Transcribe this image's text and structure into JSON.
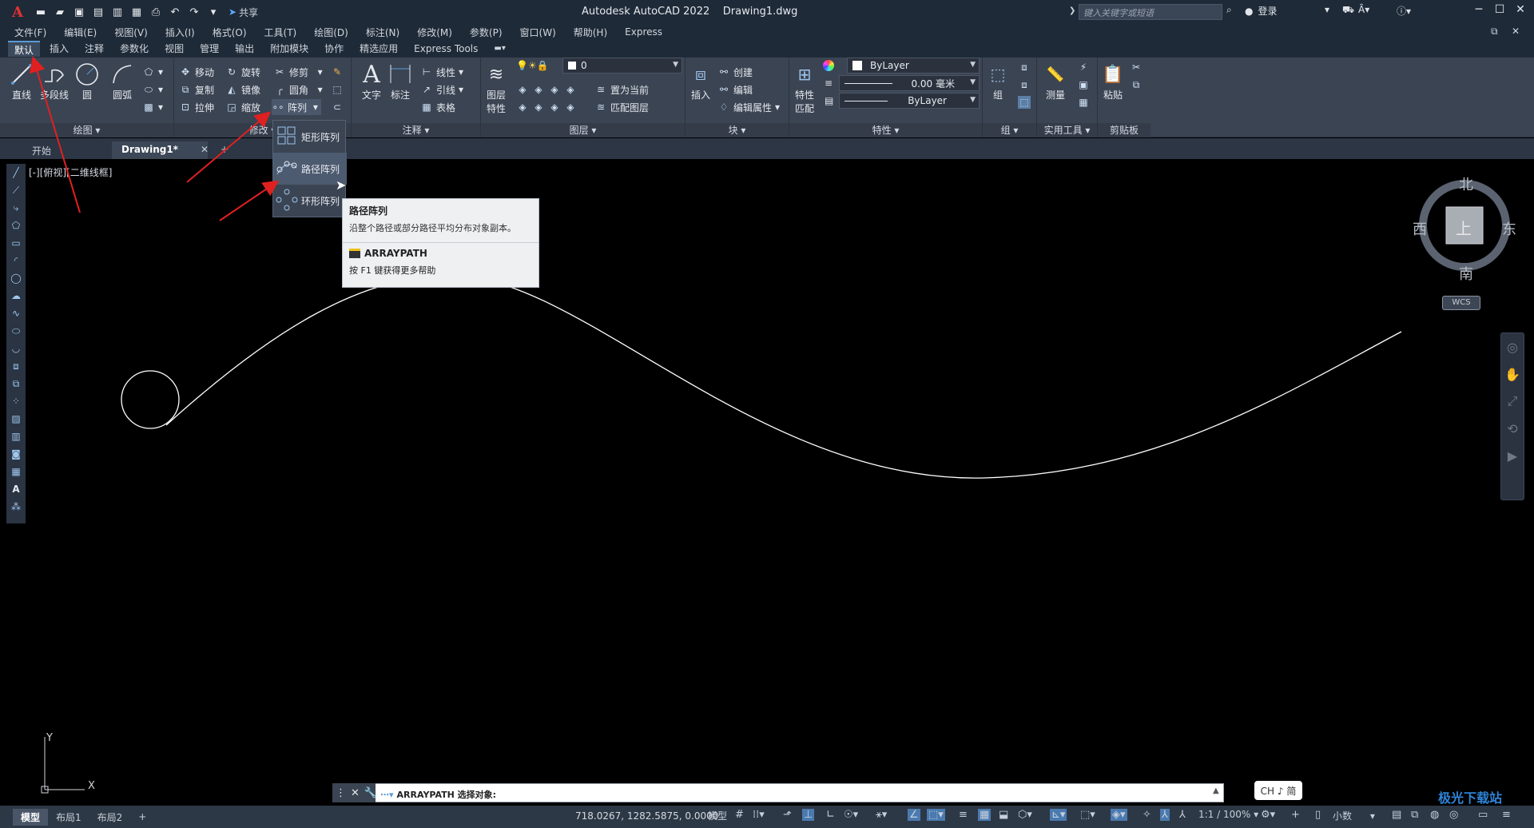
{
  "titlebar": {
    "app_logo": "A",
    "share_label": "共享",
    "title": "Autodesk AutoCAD 2022    Drawing1.dwg",
    "search_placeholder": "键入关键字或短语",
    "login_label": "登录"
  },
  "menubar": [
    "文件(F)",
    "编辑(E)",
    "视图(V)",
    "插入(I)",
    "格式(O)",
    "工具(T)",
    "绘图(D)",
    "标注(N)",
    "修改(M)",
    "参数(P)",
    "窗口(W)",
    "帮助(H)",
    "Express"
  ],
  "ribbon_tabs": [
    "默认",
    "插入",
    "注释",
    "参数化",
    "视图",
    "管理",
    "输出",
    "附加模块",
    "协作",
    "精选应用",
    "Express Tools"
  ],
  "ribbon": {
    "draw": {
      "title": "绘图",
      "line": "直线",
      "polyline": "多段线",
      "circle": "圆",
      "arc": "圆弧"
    },
    "modify": {
      "title": "修改",
      "move": "移动",
      "rotate": "旋转",
      "trim": "修剪",
      "copy": "复制",
      "mirror": "镜像",
      "fillet": "圆角",
      "stretch": "拉伸",
      "scale": "缩放",
      "array": "阵列"
    },
    "annotation": {
      "title": "注释",
      "text": "文字",
      "dimension": "标注",
      "linear": "线性",
      "leader": "引线",
      "table": "表格"
    },
    "layers": {
      "title": "图层",
      "layer_props_1": "图层",
      "layer_props_2": "特性",
      "layer_value": "0",
      "set_current": "置为当前",
      "match_layer": "匹配图层"
    },
    "block": {
      "title": "块",
      "insert": "插入",
      "create": "创建",
      "edit": "编辑",
      "edit_attr": "编辑属性"
    },
    "properties": {
      "title": "特性",
      "match_1": "特性",
      "match_2": "匹配",
      "color": "ByLayer",
      "lineweight": "0.00 毫米",
      "linetype": "ByLayer"
    },
    "groups": {
      "title": "组",
      "group": "组"
    },
    "utilities": {
      "title": "实用工具",
      "measure": "测量"
    },
    "clipboard": {
      "title": "剪贴板",
      "paste": "粘贴"
    }
  },
  "array_menu": {
    "items": [
      "矩形阵列",
      "路径阵列",
      "环形阵列"
    ]
  },
  "tooltip": {
    "title": "路径阵列",
    "description": "沿整个路径或部分路径平均分布对象副本。",
    "command": "ARRAYPATH",
    "help": "按 F1 键获得更多帮助"
  },
  "doc_tabs": [
    "开始",
    "Drawing1*"
  ],
  "viewport_label": "[-][俯视][二维线框]",
  "viewcube": {
    "north": "北",
    "south": "南",
    "east": "东",
    "west": "西",
    "face": "上",
    "wcs": "WCS"
  },
  "ucs": {
    "x": "X",
    "y": "Y"
  },
  "command_line": {
    "text": "ARRAYPATH 选择对象:"
  },
  "ime": "CH ♪ 简",
  "status": {
    "layout_tabs": [
      "模型",
      "布局1",
      "布局2"
    ],
    "coordinates": "718.0267, 1282.5875, 0.0000",
    "model_label": "模型",
    "scale": "1:1 / 100%",
    "units": "小数"
  },
  "watermark": "极光下载站",
  "colors": {
    "accent": "#5b9bd5",
    "annotation_arrow": "#e02020",
    "background": "#000000"
  }
}
